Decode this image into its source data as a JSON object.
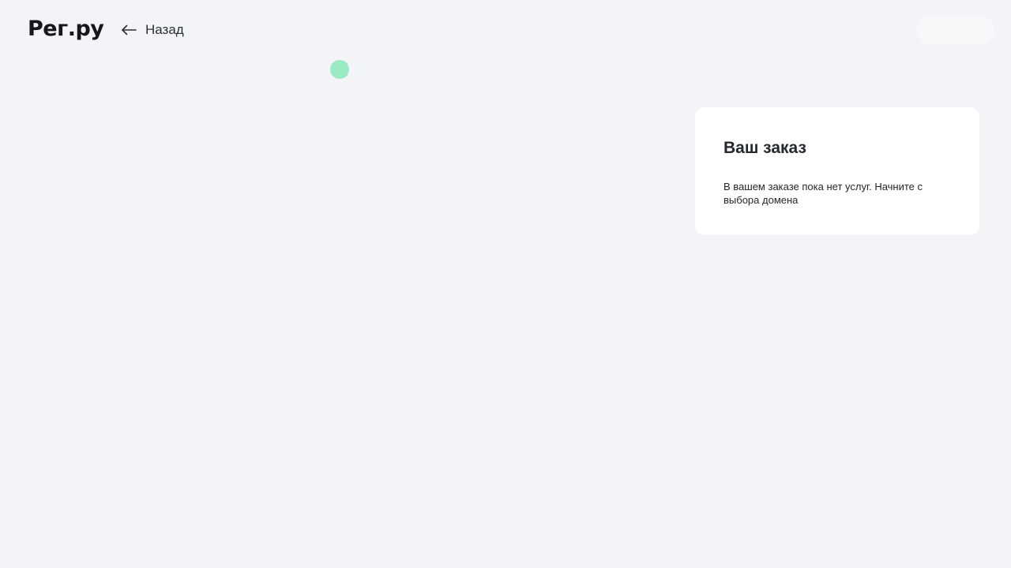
{
  "header": {
    "logo_text": "Рег.ру",
    "back_label": "Назад",
    "back_icon": "arrow-left-icon"
  },
  "order": {
    "title": "Ваш заказ",
    "empty_text": "В вашем заказе пока нет услуг. Начните с выбора домена"
  },
  "colors": {
    "background": "#f2f4f8",
    "card": "#ffffff",
    "loader": "#9aeac4",
    "text": "#23272e"
  }
}
